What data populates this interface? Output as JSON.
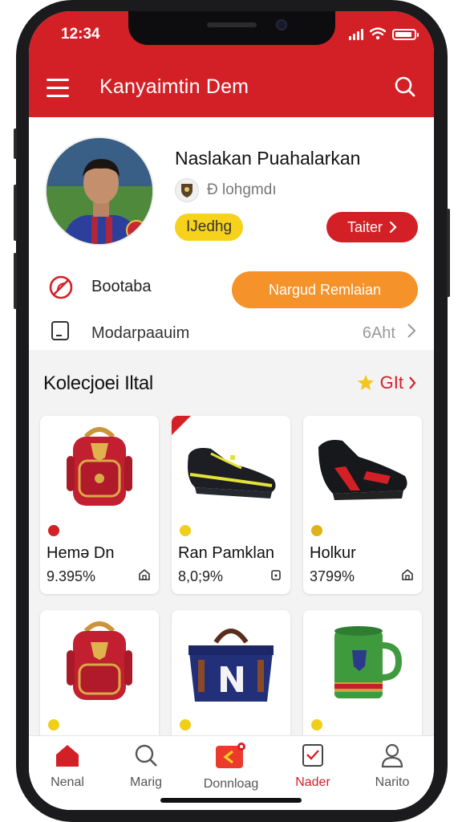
{
  "status_bar": {
    "time": "12:34"
  },
  "header": {
    "title": "Kanyaimtin Dem"
  },
  "profile": {
    "name": "Naslakan Puahalarkan",
    "subtitle": "Đ lohgmdı",
    "badge": "IJedhg",
    "action_button": "Taiter",
    "row1_label": "Bootaba",
    "row1_button": "Nargud Remlaian",
    "row2_label": "Modarpaauim",
    "row2_value": "6Aht"
  },
  "collection": {
    "title": "Kolecjoei Iltal",
    "link": "GIt",
    "items": [
      {
        "name": "Hemə Dn",
        "price": "9.395%",
        "icon": "backpack-red",
        "dot_color": "#d32027"
      },
      {
        "name": "Ran Pamklan",
        "price": "8,0;9%",
        "icon": "football-boot-black-yellow",
        "dot_color": "#f0cf1b"
      },
      {
        "name": "Holkur",
        "price": "3799%",
        "icon": "football-boot-black-red",
        "dot_color": "#e0b21a"
      },
      {
        "name": "",
        "price": "",
        "icon": "backpack-red",
        "dot_color": "#f0cf1b"
      },
      {
        "name": "",
        "price": "",
        "icon": "duffel-bag-navy",
        "dot_color": "#f0cf1b"
      },
      {
        "name": "",
        "price": "",
        "icon": "mug-green",
        "dot_color": "#f0cf1b"
      }
    ]
  },
  "nav": {
    "items": [
      {
        "label": "Nenal",
        "icon": "home-icon",
        "active": true
      },
      {
        "label": "Marig",
        "icon": "search-icon",
        "active": false
      },
      {
        "label": "Donnloag",
        "icon": "download-icon",
        "active": false
      },
      {
        "label": "Nader",
        "icon": "checklist-icon",
        "active": true
      },
      {
        "label": "Narito",
        "icon": "user-icon",
        "active": false
      }
    ]
  },
  "colors": {
    "brand_red": "#d32027",
    "accent_orange": "#f5922a",
    "accent_yellow": "#f7d21c"
  }
}
